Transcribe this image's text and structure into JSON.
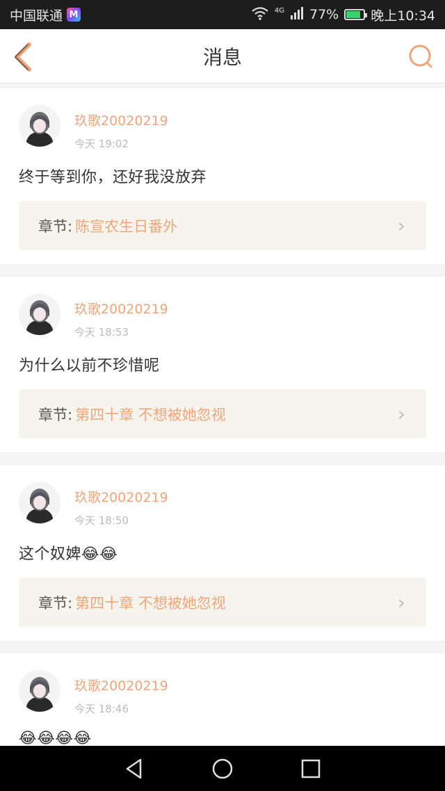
{
  "status_bar": {
    "carrier": "中国联通",
    "app_badge": "M",
    "network": "4G",
    "battery": "77%",
    "time": "晚上10:34"
  },
  "header": {
    "title": "消息"
  },
  "messages": [
    {
      "username": "玖歌20020219",
      "time": "今天 19:02",
      "text": "终于等到你，还好我没放弃",
      "chapter_label": "章节:",
      "chapter_title": "陈宣农生日番外"
    },
    {
      "username": "玖歌20020219",
      "time": "今天 18:53",
      "text": "为什么以前不珍惜呢",
      "chapter_label": "章节:",
      "chapter_title": "第四十章 不想被她忽视"
    },
    {
      "username": "玖歌20020219",
      "time": "今天 18:50",
      "text": "这个奴婢😂😂",
      "chapter_label": "章节:",
      "chapter_title": "第四十章 不想被她忽视"
    },
    {
      "username": "玖歌20020219",
      "time": "今天 18:46",
      "text": "😂😂😂😂"
    }
  ],
  "colors": {
    "accent": "#f0a47a",
    "chapter_bg": "#f5f5ed"
  }
}
